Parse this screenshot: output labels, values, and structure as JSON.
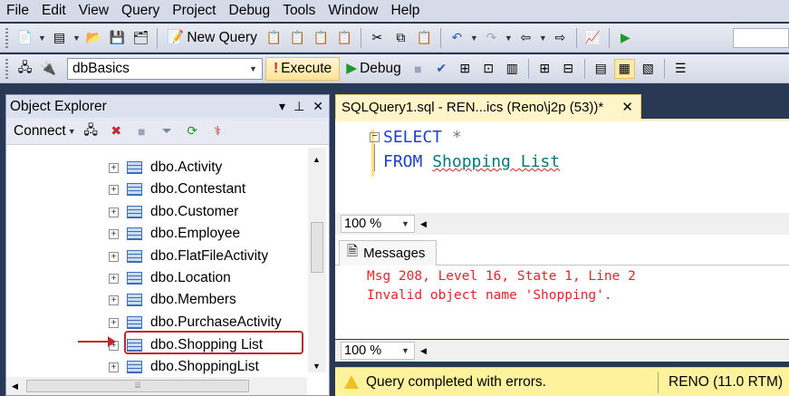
{
  "menu": [
    "File",
    "Edit",
    "View",
    "Query",
    "Project",
    "Debug",
    "Tools",
    "Window",
    "Help"
  ],
  "toolbar1": {
    "new_query": "New Query"
  },
  "toolbar2": {
    "database": "dbBasics",
    "execute": "Execute",
    "debug": "Debug"
  },
  "object_explorer": {
    "title": "Object Explorer",
    "connect": "Connect",
    "items": [
      "dbo.Activity",
      "dbo.Contestant",
      "dbo.Customer",
      "dbo.Employee",
      "dbo.FlatFileActivity",
      "dbo.Location",
      "dbo.Members",
      "dbo.PurchaseActivity",
      "dbo.Shopping List",
      "dbo.ShoppingList"
    ],
    "highlighted_item": "dbo.Shopping List"
  },
  "editor": {
    "tab_title": "SQLQuery1.sql - REN...ics (Reno\\j2p (53))*",
    "line1_kw": "SELECT",
    "line1_star": "*",
    "line2_kw": "FROM",
    "line2_obj": "Shopping List",
    "zoom": "100 %"
  },
  "messages": {
    "tab": "Messages",
    "line1": "Msg 208, Level 16, State 1, Line 2",
    "line2": "Invalid object name 'Shopping'.",
    "zoom": "100 %"
  },
  "status": {
    "text": "Query completed with errors.",
    "server": "RENO (11.0 RTM)"
  },
  "colors": {
    "error": "#e8232b",
    "keyword": "#1f3dd6",
    "highlight": "#c0282d",
    "status_bar": "#fff29d"
  }
}
